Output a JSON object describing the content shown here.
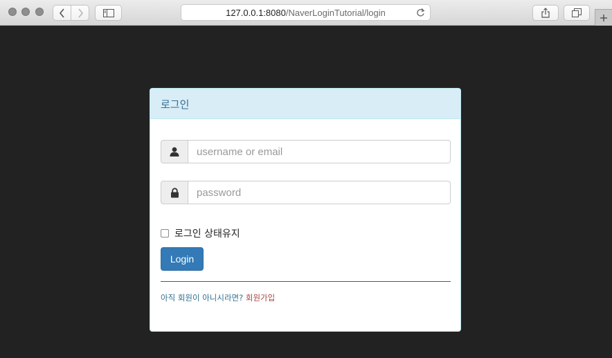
{
  "browser": {
    "url_host": "127.0.0.1:8080",
    "url_path": "/NaverLoginTutorial/login"
  },
  "panel": {
    "title": "로그인"
  },
  "form": {
    "username_placeholder": "username or email",
    "password_placeholder": "password",
    "remember_label": "로그인 상태유지",
    "remember_checked": false,
    "login_button": "Login"
  },
  "footer": {
    "question": "아직 회원이 아니시라면?",
    "signup_link": "회원가입"
  },
  "colors": {
    "page_bg": "#222222",
    "panel_heading_bg": "#d9edf7",
    "panel_title": "#31708f",
    "primary_button": "#337ab7",
    "signup_link": "#a94442"
  },
  "icons": {
    "username_addon": "user-icon",
    "password_addon": "lock-icon"
  }
}
